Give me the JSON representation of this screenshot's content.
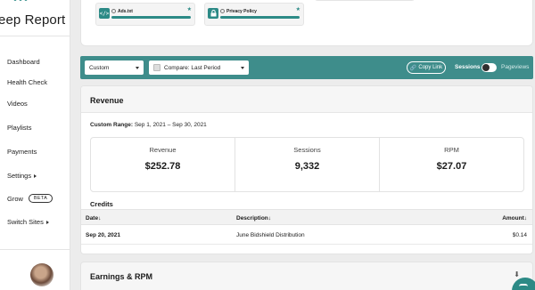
{
  "app": {
    "brand": "eep Report"
  },
  "sidebar": {
    "items": [
      {
        "label": "Dashboard",
        "icon": "dashboard-icon"
      },
      {
        "label": "Health Check",
        "icon": "health-icon"
      },
      {
        "label": "Videos",
        "icon": "video-icon"
      },
      {
        "label": "Playlists",
        "icon": "playlist-icon"
      },
      {
        "label": "Payments",
        "icon": "payments-icon"
      },
      {
        "label": "Settings",
        "icon": "settings-icon",
        "caret": true
      },
      {
        "label": "Grow",
        "badge": "BETA"
      },
      {
        "label": "Switch Sites",
        "caret": true
      }
    ]
  },
  "policies": [
    {
      "label": "Ads.txt",
      "icon": "code-icon",
      "icon_glyph": "</>"
    },
    {
      "label": "Privacy Policy",
      "icon": "lock-icon",
      "icon_glyph": "🔒"
    }
  ],
  "toolbar": {
    "range_select": "Custom",
    "compare_select": "Compare: Last Period",
    "copy_link": "Copy Link",
    "toggle_left": "Sessions",
    "toggle_right": "Pageviews",
    "accent": "#3e8d8b"
  },
  "revenue": {
    "title": "Revenue",
    "range_label": "Custom Range:",
    "range_value": "Sep 1, 2021 – Sep 30, 2021",
    "metrics": [
      {
        "label": "Revenue",
        "value": "$252.78"
      },
      {
        "label": "Sessions",
        "value": "9,332"
      },
      {
        "label": "RPM",
        "value": "$27.07"
      }
    ],
    "credits": {
      "title": "Credits",
      "headers": {
        "date": "Date",
        "description": "Description",
        "amount": "Amount"
      },
      "rows": [
        {
          "date": "Sep 20, 2021",
          "description": "June Bidshield Distribution",
          "amount": "$0.14"
        }
      ]
    }
  },
  "earnings": {
    "title": "Earnings & RPM"
  }
}
